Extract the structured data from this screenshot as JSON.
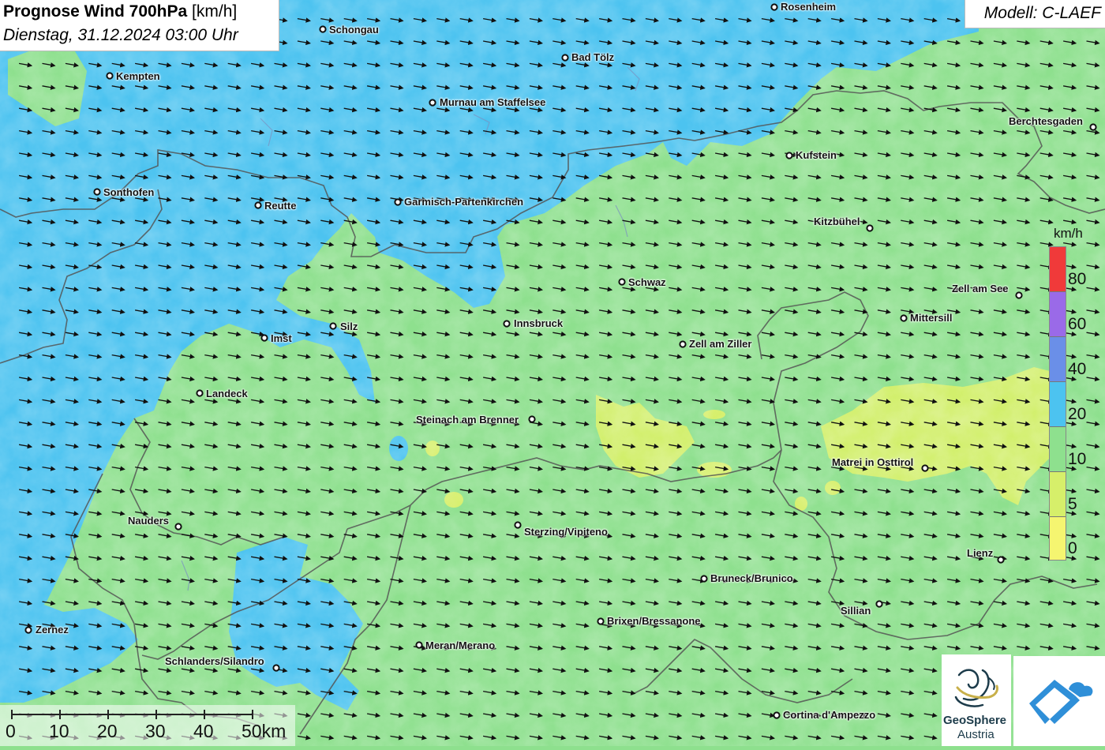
{
  "title": {
    "main": "Prognose Wind 700hPa",
    "unit": "[km/h]",
    "datetime": "Dienstag, 31.12.2024 03:00 Uhr"
  },
  "model": "Modell: C-LAEF",
  "colors": {
    "wind_0_5": "#f5f570",
    "wind_5_10": "#d6ef6a",
    "wind_10_20": "#8ee08e",
    "wind_20_40": "#4cc3f0",
    "wind_40_60": "#6a8fe8",
    "wind_60_80": "#9a6ae8",
    "wind_80_plus": "#f03a3a",
    "border": "#555555"
  },
  "legend": {
    "unit": "km/h",
    "labels": [
      "80",
      "60",
      "40",
      "20",
      "10",
      "5",
      "0"
    ]
  },
  "wind": {
    "direction_deg": 100,
    "description": "arrows pointing east-southeast"
  },
  "cities": [
    {
      "name": "Rosenheim"
    },
    {
      "name": "Schongau"
    },
    {
      "name": "Bad Tölz"
    },
    {
      "name": "Kempten"
    },
    {
      "name": "Murnau am Staffelsee"
    },
    {
      "name": "Berchtesgaden"
    },
    {
      "name": "Kufstein"
    },
    {
      "name": "Sonthofen"
    },
    {
      "name": "Reutte"
    },
    {
      "name": "Garmisch-Partenkirchen"
    },
    {
      "name": "Kitzbühel"
    },
    {
      "name": "Schwaz"
    },
    {
      "name": "Zell am See"
    },
    {
      "name": "Mittersill"
    },
    {
      "name": "Innsbruck"
    },
    {
      "name": "Silz"
    },
    {
      "name": "Imst"
    },
    {
      "name": "Zell am Ziller"
    },
    {
      "name": "Landeck"
    },
    {
      "name": "Steinach am Brenner"
    },
    {
      "name": "Matrei in Osttirol"
    },
    {
      "name": "Nauders"
    },
    {
      "name": "Sterzing/Vipiteno"
    },
    {
      "name": "Lienz"
    },
    {
      "name": "Bruneck/Brunico"
    },
    {
      "name": "Sillian"
    },
    {
      "name": "Brixen/Bressanone"
    },
    {
      "name": "Zernez"
    },
    {
      "name": "Meran/Merano"
    },
    {
      "name": "Schlanders/Silandro"
    },
    {
      "name": "Cortina d'Ampezzo"
    }
  ],
  "scale": {
    "labels": [
      "0",
      "10",
      "20",
      "30",
      "40",
      "50km"
    ]
  },
  "logos": {
    "geosphere_line1": "GeoSphere",
    "geosphere_line2": "Austria"
  }
}
